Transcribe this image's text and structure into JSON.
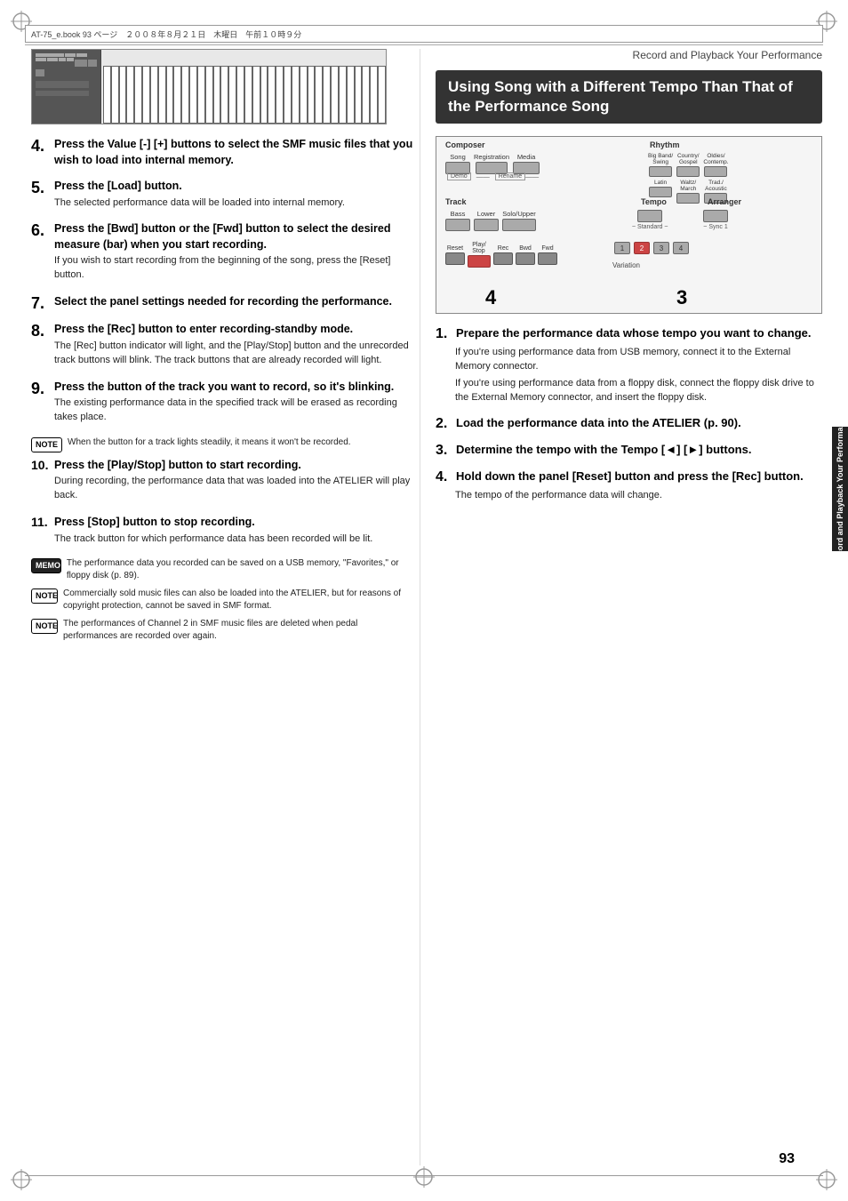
{
  "page": {
    "number": "93",
    "header_text": "AT-75_e.book 93 ページ　２００８年８月２１日　木曜日　午前１０時９分",
    "right_section_title": "Record and Playback Your Performance",
    "side_tab_label": "Record and Playback Your Performance"
  },
  "section_header": {
    "title": "Using Song with a Different Tempo Than That of the Performance Song"
  },
  "left_steps": [
    {
      "num": "4.",
      "title": "Press the Value [-] [+] buttons to select the SMF music files that you wish to load into internal memory.",
      "body": ""
    },
    {
      "num": "5.",
      "title": "Press the [Load] button.",
      "body": "The selected performance data will be loaded into internal memory."
    },
    {
      "num": "6.",
      "title": "Press the [Bwd] button or the [Fwd] button to select the desired measure (bar) when you start recording.",
      "body": "If you wish to start recording from the beginning of the song, press the [Reset] button."
    },
    {
      "num": "7.",
      "title": "Select the panel settings needed for recording the performance.",
      "body": ""
    },
    {
      "num": "8.",
      "title": "Press the [Rec] button to enter recording-standby mode.",
      "body": "The [Rec] button indicator will light, and the [Play/Stop] button and the unrecorded track buttons will blink. The track buttons that are already recorded will light."
    },
    {
      "num": "9.",
      "title": "Press the button of the track you want to record, so it's blinking.",
      "body": "The existing performance data in the specified track will be erased as recording takes place."
    },
    {
      "num": "10.",
      "title": "Press the [Play/Stop] button to start recording.",
      "body": "During recording, the performance data that was loaded into the ATELIER will play back."
    },
    {
      "num": "11.",
      "title": "Press [Stop] button to stop recording.",
      "body": "The track button for which performance data has been recorded will be lit."
    }
  ],
  "notes": [
    {
      "type": "note",
      "label": "NOTE",
      "text": "When the button for a track lights steadily, it means it won't be recorded."
    },
    {
      "type": "memo",
      "label": "MEMO",
      "text": "The performance data you recorded can be saved on a USB memory, \"Favorites,\" or floppy disk (p. 89)."
    },
    {
      "type": "note",
      "label": "NOTE",
      "text": "Commercially sold music files can also be loaded into the ATELIER, but for reasons of copyright protection, cannot be saved in SMF format."
    },
    {
      "type": "note",
      "label": "NOTE",
      "text": "The performances of Channel 2 in SMF music files are deleted when pedal performances are recorded over again."
    }
  ],
  "right_steps": [
    {
      "num": "1.",
      "title": "Prepare the performance data whose tempo you want to change.",
      "body1": "If you're using performance data from USB memory, connect it to the External Memory connector.",
      "body2": "If you're using performance data from a floppy disk, connect the floppy disk drive to the External Memory connector, and insert the floppy disk."
    },
    {
      "num": "2.",
      "title": "Load the performance data into the ATELIER (p. 90).",
      "body1": "",
      "body2": ""
    },
    {
      "num": "3.",
      "title": "Determine the tempo with the Tempo [◄] [►] buttons.",
      "body1": "",
      "body2": ""
    },
    {
      "num": "4.",
      "title": "Hold down the panel [Reset] button and press the [Rec] button.",
      "body1": "The tempo of the performance data will change.",
      "body2": ""
    }
  ],
  "diagram": {
    "composer_label": "Composer",
    "rhythm_label": "Rhythm",
    "track_label": "Track",
    "tempo_label": "Tempo",
    "arranger_label": "Arranger",
    "number_4": "4",
    "number_3": "3",
    "song_label": "Song",
    "registration_label": "Registration",
    "media_label": "Media",
    "demo_label": "Demo",
    "rename_label": "Rename",
    "bass_label": "Bass",
    "lower_label": "Lower",
    "solo_upper_label": "Solo/Upper",
    "standard_label": "~ Standard ~",
    "sync_label": "~ Sync 1",
    "variation_label": "Variation",
    "play_stop_label": "Play/Stop",
    "reset_label": "Reset",
    "rec_label": "Rec",
    "bwd_label": "Bwd",
    "fwd_label": "Fwd"
  }
}
